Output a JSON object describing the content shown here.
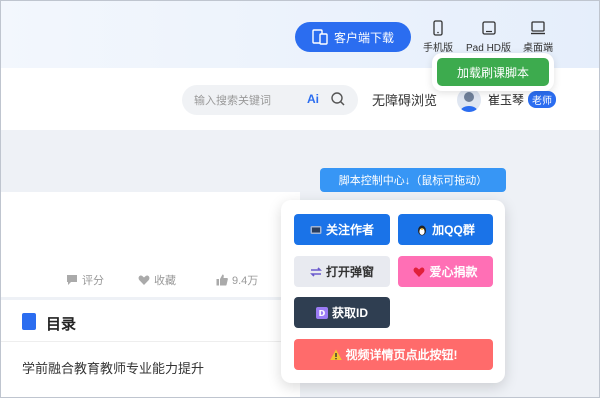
{
  "header": {
    "download_label": "客户端下载",
    "devices": [
      {
        "label": "手机版",
        "icon": "phone-icon"
      },
      {
        "label": "Pad HD版",
        "icon": "tablet-icon"
      },
      {
        "label": "桌面端",
        "icon": "desktop-icon"
      }
    ]
  },
  "nav": {
    "search_placeholder": "输入搜索关键词",
    "ai_label": "Ai",
    "accessibility_label": "无障碍浏览",
    "user_name": "崔玉琴",
    "user_badge": "老师"
  },
  "script_button_label": "加载刷课脚本",
  "content": {
    "stats": [
      {
        "label": "评分",
        "icon": "comment-icon"
      },
      {
        "label": "收藏",
        "icon": "heart-icon"
      },
      {
        "label": "9.4万",
        "icon": "thumbs-up-icon"
      }
    ],
    "toc_title": "目录",
    "toc_item": "学前融合教育教师专业能力提升"
  },
  "control_panel": {
    "title": "脚本控制中心↓（鼠标可拖动）",
    "buttons": {
      "follow": "关注作者",
      "qq": "加QQ群",
      "popup": "打开弹窗",
      "donate": "爱心捐款",
      "get_id": "获取ID",
      "video": "视频详情页点此按钮!"
    }
  },
  "colors": {
    "primary": "#2b6df0",
    "green": "#3dab4e",
    "blue_btn": "#1a73e8",
    "pink": "#ff6fb5",
    "dark": "#2f3e51",
    "red": "#ff6b6b",
    "light": "#e8eaf0"
  }
}
